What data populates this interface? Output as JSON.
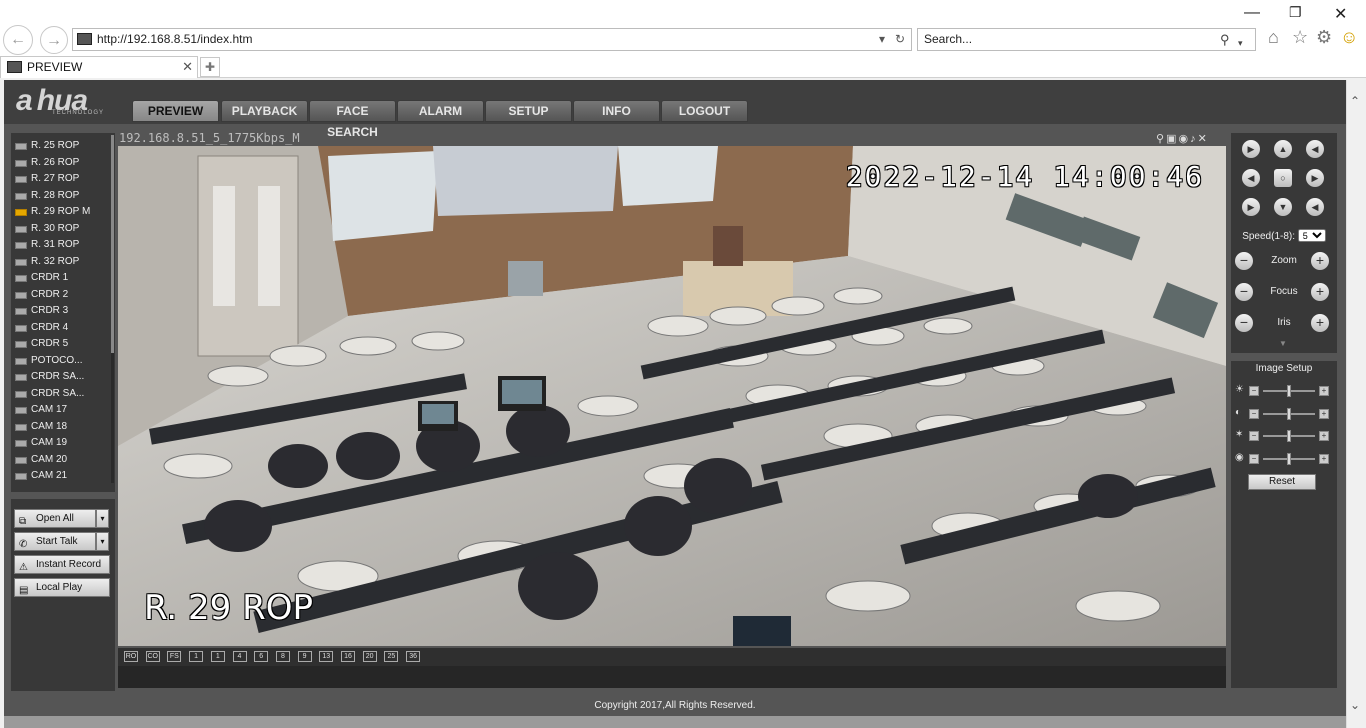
{
  "browser": {
    "url": "http://192.168.8.51/index.htm",
    "search_placeholder": "Search...",
    "tab_title": "PREVIEW"
  },
  "app": {
    "logo": "a hua",
    "logo_sub": "TECHNOLOGY",
    "nav": [
      "PREVIEW",
      "PLAYBACK",
      "FACE SEARCH",
      "ALARM",
      "SETUP",
      "INFO",
      "LOGOUT"
    ],
    "active_nav": "PREVIEW",
    "cameras": [
      {
        "label": "R. 25 ROP"
      },
      {
        "label": "R. 26 ROP"
      },
      {
        "label": "R. 27 ROP"
      },
      {
        "label": "R. 28 ROP"
      },
      {
        "label": "R. 29 ROP   M"
      },
      {
        "label": "R. 30 ROP"
      },
      {
        "label": "R. 31 ROP"
      },
      {
        "label": "R. 32 ROP"
      },
      {
        "label": "CRDR 1"
      },
      {
        "label": "CRDR 2"
      },
      {
        "label": "CRDR 3"
      },
      {
        "label": "CRDR 4"
      },
      {
        "label": "CRDR 5"
      },
      {
        "label": "POTOCO..."
      },
      {
        "label": "CRDR SA..."
      },
      {
        "label": "CRDR SA..."
      },
      {
        "label": "CAM 17"
      },
      {
        "label": "CAM 18"
      },
      {
        "label": "CAM 19"
      },
      {
        "label": "CAM 20"
      },
      {
        "label": "CAM 21"
      }
    ],
    "recording_camera_index": 4,
    "buttons": {
      "open_all": "Open All",
      "start_talk": "Start Talk",
      "instant_record": "Instant Record",
      "local_play": "Local Play"
    },
    "video": {
      "stream_label": "192.168.8.51_5_1775Kbps_M",
      "timestamp": "2022-12-14 14:00:46",
      "camera_name": "R. 29 ROP"
    },
    "layout_buttons": [
      "RO",
      "CO",
      "FS",
      "1",
      "1",
      "4",
      "6",
      "8",
      "9",
      "13",
      "16",
      "20",
      "25",
      "36"
    ],
    "ptz": {
      "speed_label": "Speed(1-8):",
      "speed_value": "5",
      "zoom": "Zoom",
      "focus": "Focus",
      "iris": "Iris"
    },
    "image_setup": {
      "title": "Image Setup",
      "sliders": [
        {
          "icon": "brightness-icon",
          "level": 0.5
        },
        {
          "icon": "contrast-icon",
          "level": 0.5
        },
        {
          "icon": "saturation-icon",
          "level": 0.5
        },
        {
          "icon": "hue-icon",
          "level": 0.5
        }
      ],
      "reset": "Reset"
    },
    "copyright": "Copyright 2017,All Rights Reserved."
  },
  "colors": {
    "app_bg": "#555555",
    "panel_bg": "#383838",
    "active_tab": "#9a9a9a",
    "rec_icon": "#e5a800"
  }
}
